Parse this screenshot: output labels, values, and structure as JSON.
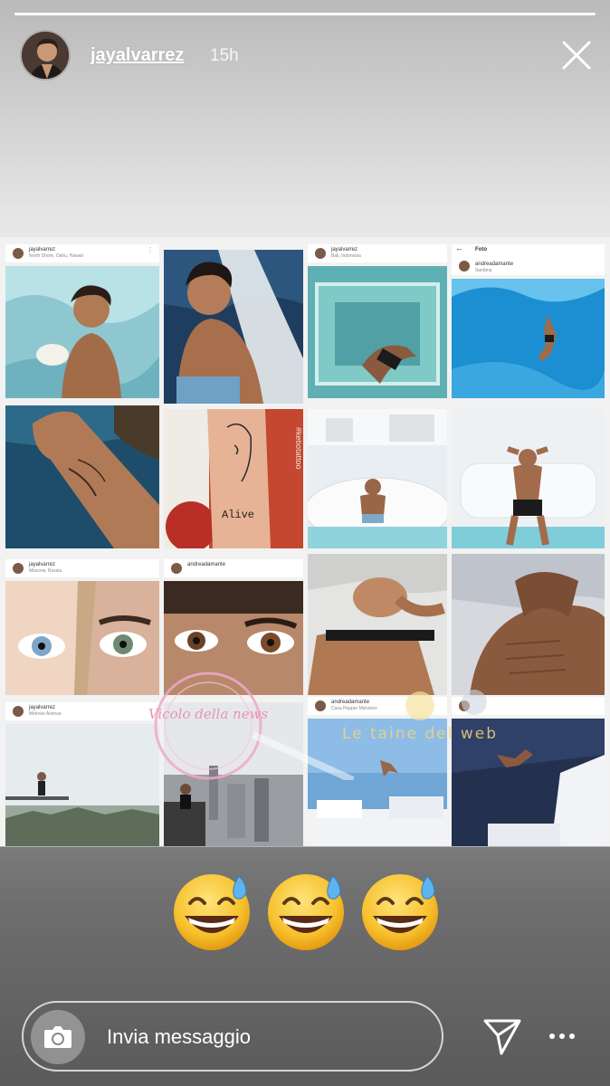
{
  "story": {
    "username": "jayalvarrez",
    "time_ago": "15h",
    "progress": 1.0
  },
  "tiles": [
    {
      "handle": "jayalvarrez",
      "place": "North Shore, Oahu, Hawaii"
    },
    {
      "handle": "jayalvarrez",
      "place": "Bali, Indonesia"
    },
    {
      "handle": "andreadamante",
      "place": "Sardinia",
      "title": "Foto"
    },
    {
      "handle": "jayalvarrez",
      "place": "Moscow, Russia"
    },
    {
      "handle": "andreadamante",
      "place": ""
    },
    {
      "handle": "jayalvarrez",
      "place": "Melrose Avenue"
    },
    {
      "handle": "andreadamante",
      "place": "Casa Pepper Mykonos"
    }
  ],
  "tattoo_text": {
    "word": "Alive",
    "tag": "#ketiotattoo"
  },
  "watermark": {
    "left": "Vicolo della news",
    "right": "Le taine del web"
  },
  "reactions": [
    "grinning-sweat-emoji",
    "grinning-sweat-emoji",
    "grinning-sweat-emoji"
  ],
  "footer": {
    "message_placeholder": "Invia messaggio"
  }
}
